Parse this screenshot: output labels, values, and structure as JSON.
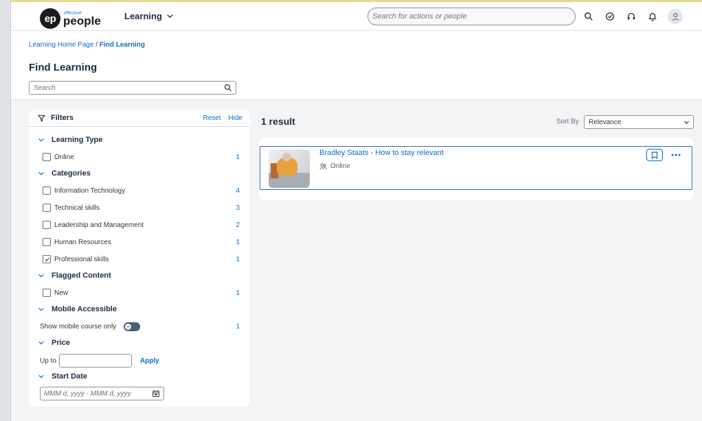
{
  "header": {
    "logo_small": "effective",
    "logo_big": "people",
    "logo_mark": "ep",
    "menu_label": "Learning",
    "search_placeholder": "Search for actions or people",
    "icons": [
      "search-icon",
      "checkmark-circle-icon",
      "headset-icon",
      "bell-icon",
      "user-avatar-icon"
    ]
  },
  "breadcrumb": {
    "home": "Learning Home Page",
    "separator": "/",
    "current": "Find Learning"
  },
  "page": {
    "title": "Find Learning",
    "search_placeholder": "Search"
  },
  "filters": {
    "title": "Filters",
    "reset_label": "Reset",
    "hide_label": "Hide",
    "sections": {
      "learning_type": {
        "label": "Learning Type",
        "items": [
          {
            "label": "Online",
            "count": "1",
            "checked": false
          }
        ]
      },
      "categories": {
        "label": "Categories",
        "items": [
          {
            "label": "Information Technology",
            "count": "4",
            "checked": false
          },
          {
            "label": "Technical skills",
            "count": "3",
            "checked": false
          },
          {
            "label": "Leadership and Management",
            "count": "2",
            "checked": false
          },
          {
            "label": "Human Resources",
            "count": "1",
            "checked": false
          },
          {
            "label": "Professional skills",
            "count": "1",
            "checked": true
          }
        ]
      },
      "flagged": {
        "label": "Flagged Content",
        "items": [
          {
            "label": "New",
            "count": "1",
            "checked": false
          }
        ]
      },
      "mobile": {
        "label": "Mobile Accessible",
        "toggle_label": "Show mobile course only",
        "count": "1",
        "toggle_on": false
      },
      "price": {
        "label": "Price",
        "up_to_label": "Up to",
        "value": "",
        "apply_label": "Apply"
      },
      "start_date": {
        "label": "Start Date",
        "placeholder": "MMM d, yyyy - MMM d, yyyy"
      }
    }
  },
  "results": {
    "count_label": "1 result",
    "sort_label": "Sort By",
    "sort_value": "Relevance",
    "items": [
      {
        "title": "Bradley Staats - How to stay relevant",
        "type": "Online"
      }
    ]
  },
  "colors": {
    "accent": "#0a6ed1",
    "card_border": "#2b6cb0",
    "text": "#32363a"
  }
}
